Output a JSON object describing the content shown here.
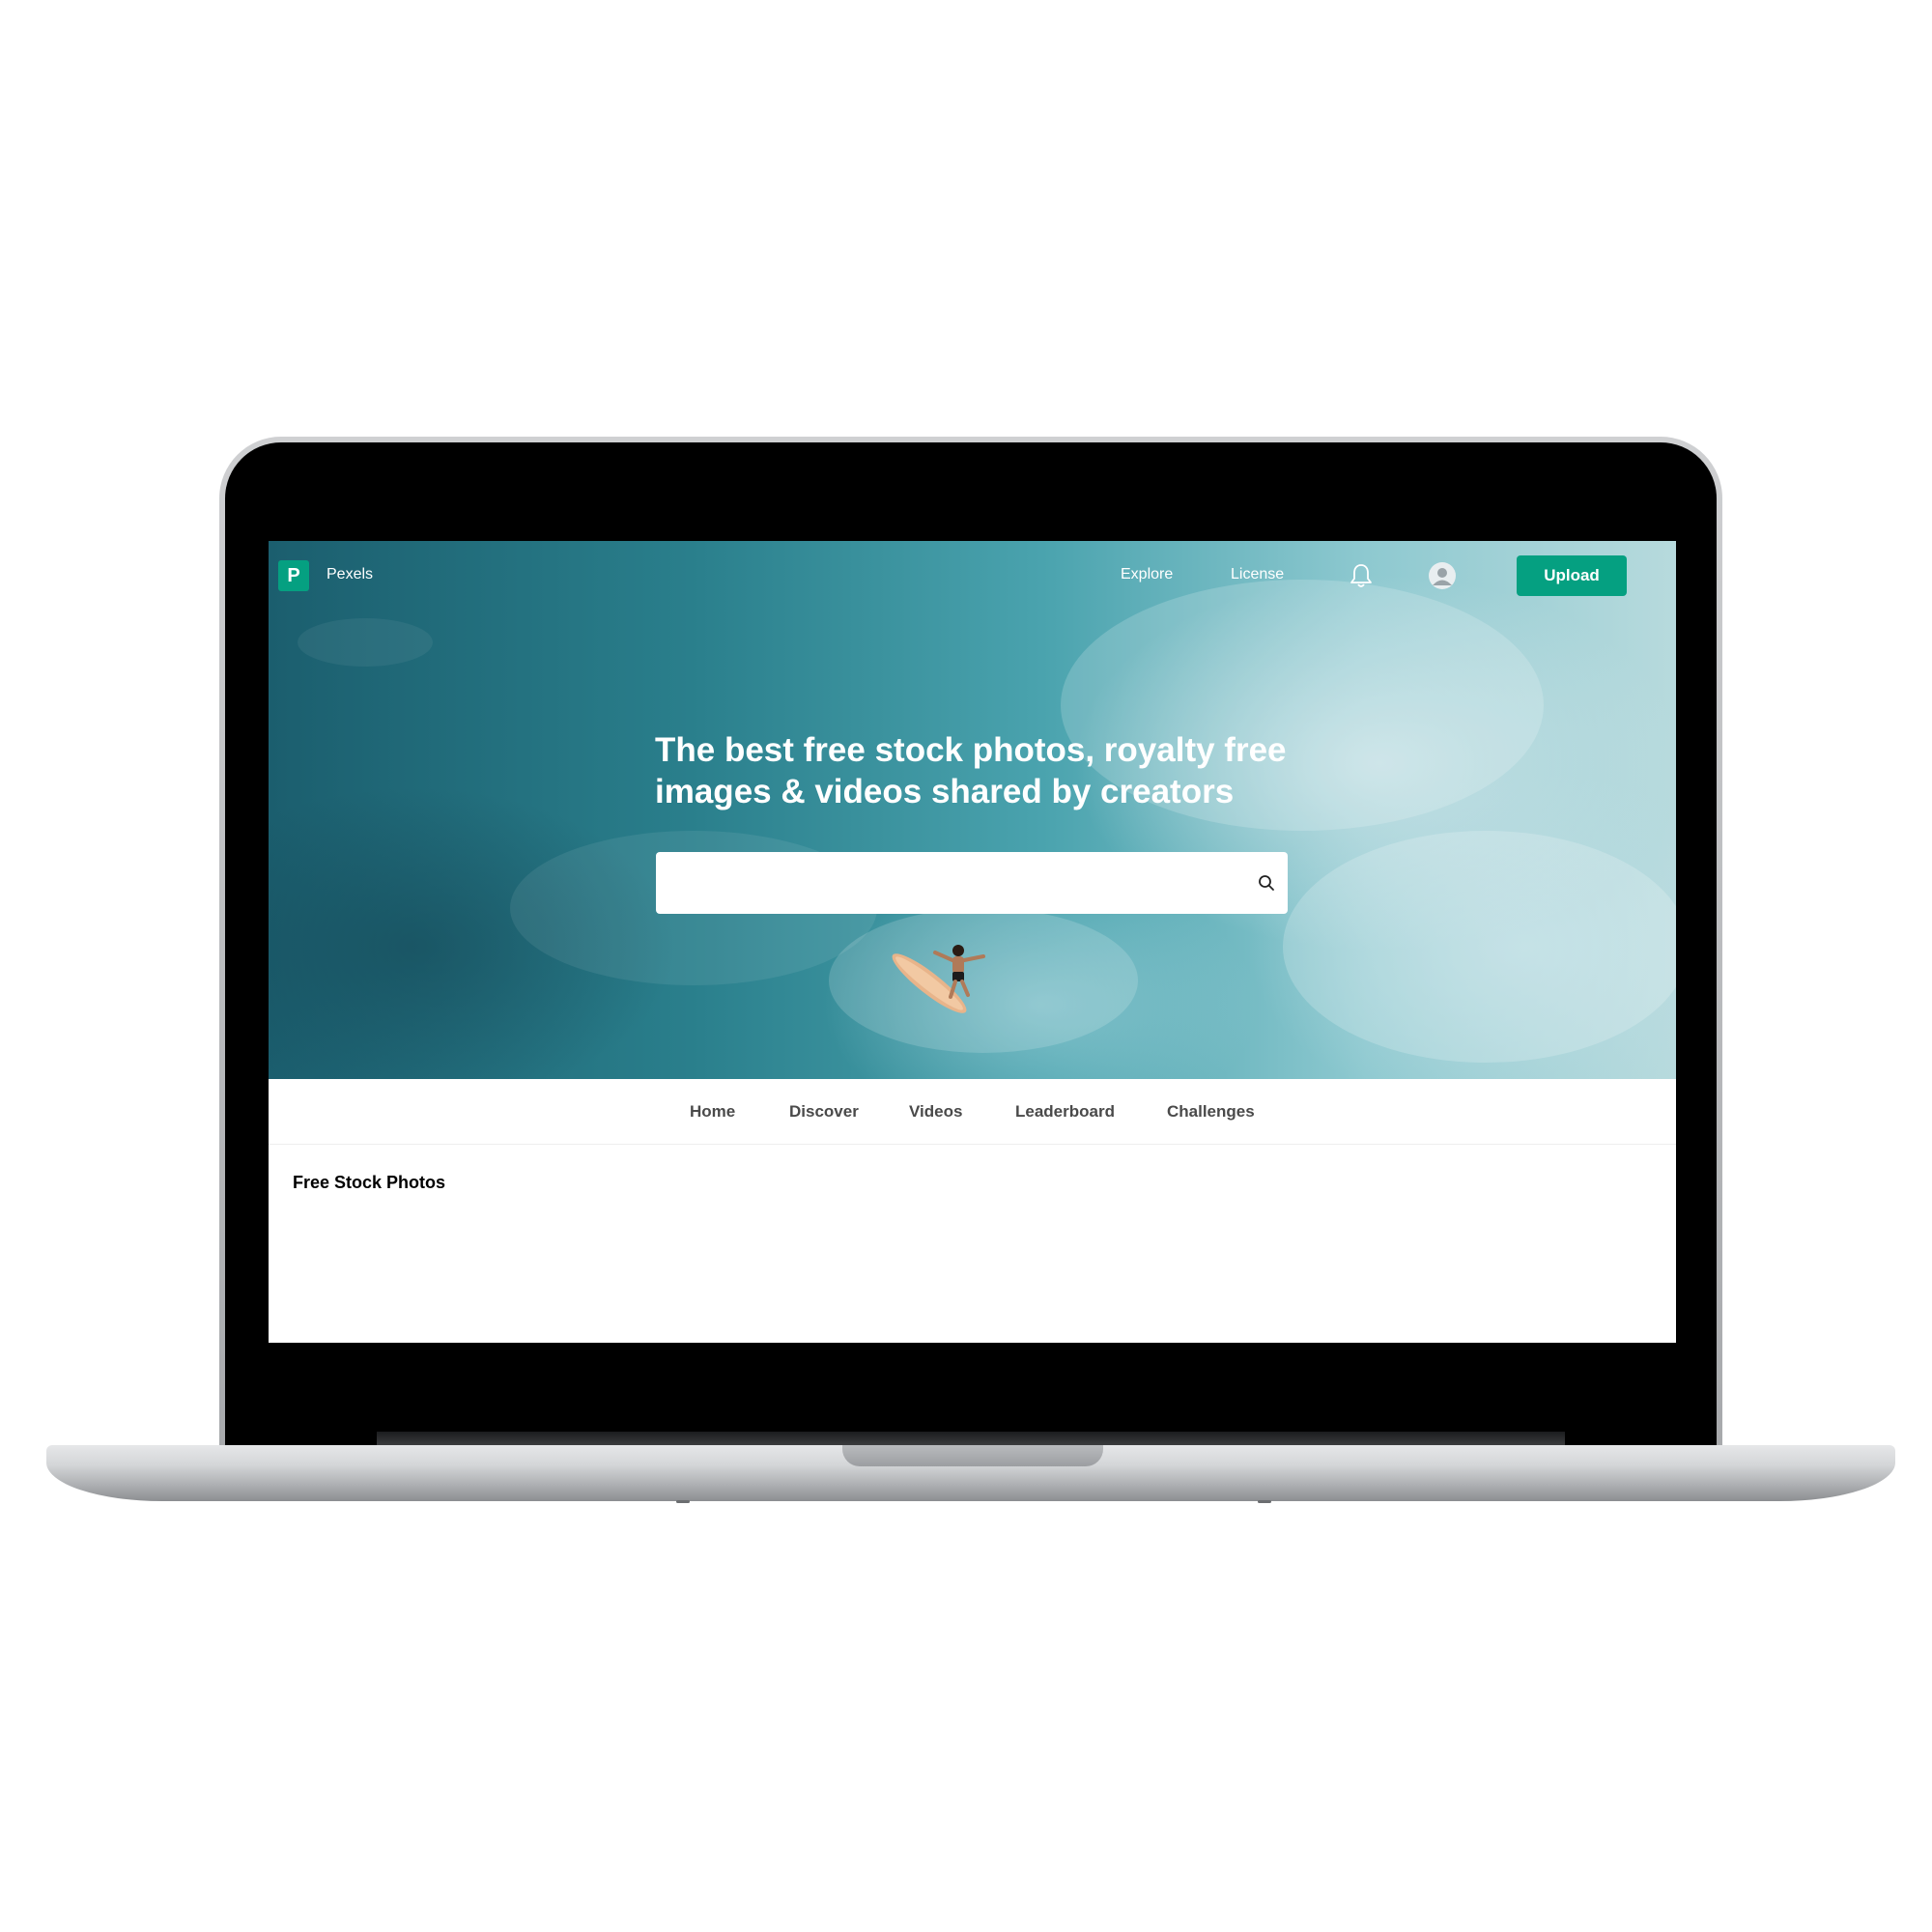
{
  "header": {
    "logo_letter": "P",
    "logo_text": "Pexels",
    "nav": [
      "Explore",
      "License"
    ],
    "upload_label": "Upload",
    "brand_color": "#05a081"
  },
  "hero": {
    "headline_line1": "The best free stock photos, royalty free",
    "headline_line2": "images & videos shared by creators",
    "search_value": "",
    "search_placeholder": ""
  },
  "tabs": [
    "Home",
    "Discover",
    "Videos",
    "Leaderboard",
    "Challenges"
  ],
  "section_title": "Free Stock Photos",
  "icons": {
    "logo": "pexels-logo-icon",
    "bell": "bell-icon",
    "avatar": "user-avatar-icon",
    "search": "search-icon"
  }
}
